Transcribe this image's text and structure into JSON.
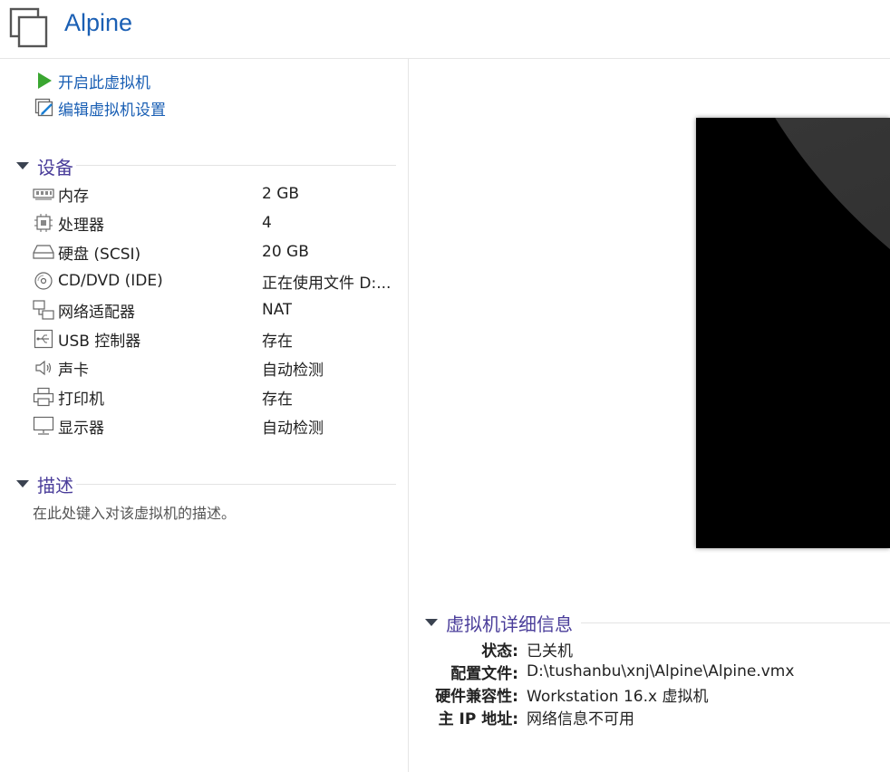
{
  "vm": {
    "name": "Alpine"
  },
  "commands": [
    {
      "label": "开启此虚拟机",
      "icon": "play-icon"
    },
    {
      "label": "编辑虚拟机设置",
      "icon": "edit-settings-icon"
    }
  ],
  "devices": {
    "title": "设备",
    "items": [
      {
        "label": "内存",
        "value": "2 GB",
        "icon": "memory-icon"
      },
      {
        "label": "处理器",
        "value": "4",
        "icon": "processor-icon"
      },
      {
        "label": "硬盘 (SCSI)",
        "value": "20 GB",
        "icon": "hard-disk-icon"
      },
      {
        "label": "CD/DVD (IDE)",
        "value": "正在使用文件 D:...",
        "icon": "cd-dvd-icon"
      },
      {
        "label": "网络适配器",
        "value": "NAT",
        "icon": "network-adapter-icon"
      },
      {
        "label": "USB 控制器",
        "value": "存在",
        "icon": "usb-icon"
      },
      {
        "label": "声卡",
        "value": "自动检测",
        "icon": "speaker-icon"
      },
      {
        "label": "打印机",
        "value": "存在",
        "icon": "printer-icon"
      },
      {
        "label": "显示器",
        "value": "自动检测",
        "icon": "monitor-icon"
      }
    ]
  },
  "description": {
    "title": "描述",
    "placeholder": "在此处键入对该虚拟机的描述。"
  },
  "details": {
    "title": "虚拟机详细信息",
    "rows": [
      {
        "key": "状态:",
        "value": "已关机"
      },
      {
        "key": "配置文件:",
        "value": "D:\\tushanbu\\xnj\\Alpine\\Alpine.vmx"
      },
      {
        "key": "硬件兼容性:",
        "value": "Workstation 16.x 虚拟机"
      },
      {
        "key": "主 IP 地址:",
        "value": "网络信息不可用"
      }
    ]
  },
  "colors": {
    "link": "#1a5fb4",
    "section": "#4a3d9a",
    "play": "#3aa631"
  }
}
